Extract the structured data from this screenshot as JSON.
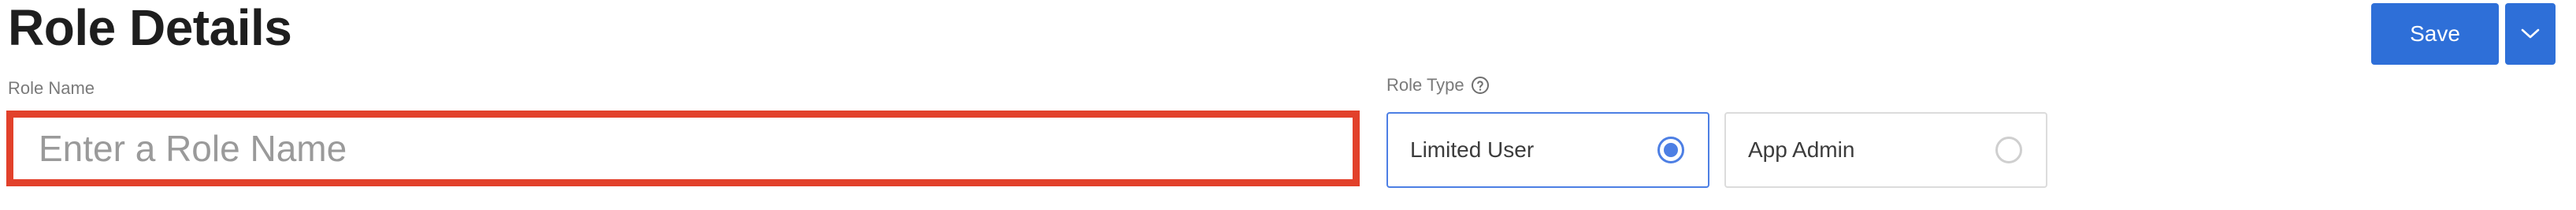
{
  "header": {
    "title": "Role Details",
    "save_label": "Save",
    "more_actions_icon": "chevron-down-icon"
  },
  "role_name": {
    "label": "Role Name",
    "value": "",
    "placeholder": "Enter a Role Name"
  },
  "role_type": {
    "label": "Role Type",
    "help_icon": "question-circle-icon",
    "options": [
      {
        "label": "Limited User",
        "selected": true
      },
      {
        "label": "App Admin",
        "selected": false
      }
    ]
  },
  "colors": {
    "accent": "#2e6fd8",
    "selected_border": "#4d7fe4",
    "error_border": "#e2412b"
  }
}
